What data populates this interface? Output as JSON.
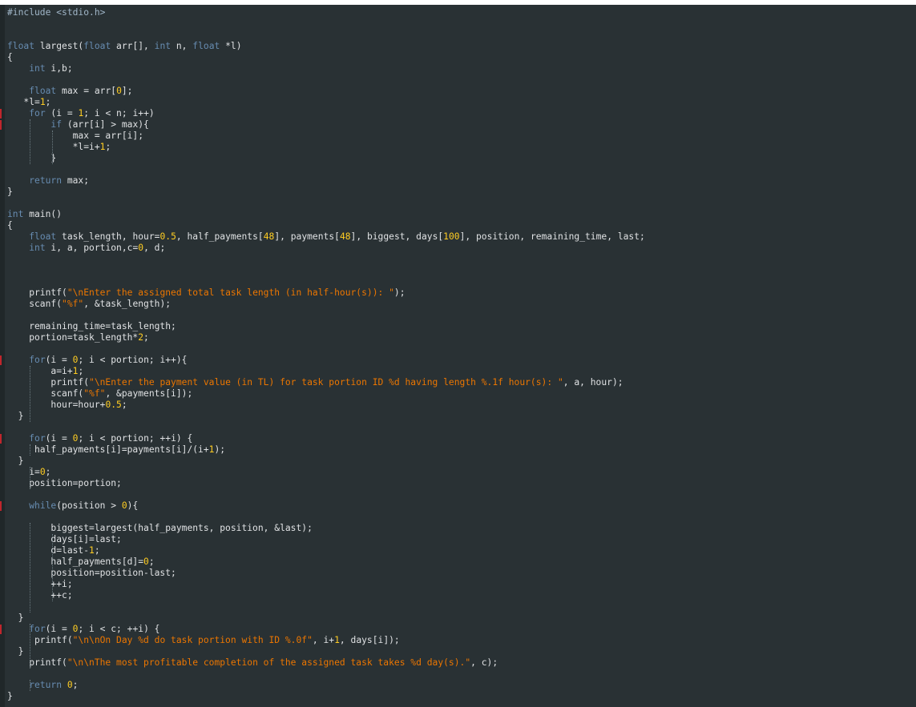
{
  "editor": {
    "language": "c",
    "theme_colors": {
      "background": "#293134",
      "keyword": "#678cb1",
      "string": "#ec7600",
      "number": "#ffcd22",
      "preprocessor": "#a1b7c9",
      "identifier": "#e0e2e4",
      "marker": "#c0262d"
    },
    "lines": [
      {
        "tokens": [
          {
            "t": "#include <stdio.h>",
            "c": "pp"
          }
        ]
      },
      {
        "tokens": []
      },
      {
        "tokens": []
      },
      {
        "tokens": [
          {
            "t": "float",
            "c": "kw"
          },
          {
            "t": " largest(",
            "c": "id"
          },
          {
            "t": "float",
            "c": "kw"
          },
          {
            "t": " arr[], ",
            "c": "id"
          },
          {
            "t": "int",
            "c": "kw"
          },
          {
            "t": " n, ",
            "c": "id"
          },
          {
            "t": "float",
            "c": "kw"
          },
          {
            "t": " *l)",
            "c": "id"
          }
        ]
      },
      {
        "tokens": [
          {
            "t": "{",
            "c": "id"
          }
        ]
      },
      {
        "tokens": [
          {
            "t": "    ",
            "c": "id"
          },
          {
            "t": "int",
            "c": "kw"
          },
          {
            "t": " i,b;",
            "c": "id"
          }
        ]
      },
      {
        "tokens": []
      },
      {
        "tokens": [
          {
            "t": "    ",
            "c": "id"
          },
          {
            "t": "float",
            "c": "kw"
          },
          {
            "t": " max = arr[",
            "c": "id"
          },
          {
            "t": "0",
            "c": "num"
          },
          {
            "t": "];",
            "c": "id"
          }
        ]
      },
      {
        "tokens": [
          {
            "t": "   *l=",
            "c": "id"
          },
          {
            "t": "1",
            "c": "num"
          },
          {
            "t": ";",
            "c": "id"
          }
        ]
      },
      {
        "marker": true,
        "tokens": [
          {
            "t": "    ",
            "c": "id"
          },
          {
            "t": "for",
            "c": "kw"
          },
          {
            "t": " (i = ",
            "c": "id"
          },
          {
            "t": "1",
            "c": "num"
          },
          {
            "t": "; i < n; i++)",
            "c": "id"
          }
        ]
      },
      {
        "marker": true,
        "tokens": [
          {
            "t": "        ",
            "c": "id"
          },
          {
            "t": "if",
            "c": "kw"
          },
          {
            "t": " (arr[i] > max){",
            "c": "id"
          }
        ]
      },
      {
        "tokens": [
          {
            "t": "            max = arr[i];",
            "c": "id"
          }
        ]
      },
      {
        "tokens": [
          {
            "t": "            *l=i+",
            "c": "id"
          },
          {
            "t": "1",
            "c": "num"
          },
          {
            "t": ";",
            "c": "id"
          }
        ]
      },
      {
        "tokens": [
          {
            "t": "        }",
            "c": "id"
          }
        ]
      },
      {
        "tokens": []
      },
      {
        "tokens": [
          {
            "t": "    ",
            "c": "id"
          },
          {
            "t": "return",
            "c": "kw"
          },
          {
            "t": " max;",
            "c": "id"
          }
        ]
      },
      {
        "tokens": [
          {
            "t": "}",
            "c": "id"
          }
        ]
      },
      {
        "tokens": []
      },
      {
        "tokens": [
          {
            "t": "int",
            "c": "kw"
          },
          {
            "t": " main()",
            "c": "id"
          }
        ]
      },
      {
        "tokens": [
          {
            "t": "{",
            "c": "id"
          }
        ]
      },
      {
        "tokens": [
          {
            "t": "    ",
            "c": "id"
          },
          {
            "t": "float",
            "c": "kw"
          },
          {
            "t": " task_length, hour=",
            "c": "id"
          },
          {
            "t": "0.5",
            "c": "num"
          },
          {
            "t": ", half_payments[",
            "c": "id"
          },
          {
            "t": "48",
            "c": "num"
          },
          {
            "t": "], payments[",
            "c": "id"
          },
          {
            "t": "48",
            "c": "num"
          },
          {
            "t": "], biggest, days[",
            "c": "id"
          },
          {
            "t": "100",
            "c": "num"
          },
          {
            "t": "], position, remaining_time, last;",
            "c": "id"
          }
        ]
      },
      {
        "tokens": [
          {
            "t": "    ",
            "c": "id"
          },
          {
            "t": "int",
            "c": "kw"
          },
          {
            "t": " i, a, portion,c=",
            "c": "id"
          },
          {
            "t": "0",
            "c": "num"
          },
          {
            "t": ", d;",
            "c": "id"
          }
        ]
      },
      {
        "tokens": []
      },
      {
        "tokens": []
      },
      {
        "tokens": []
      },
      {
        "tokens": [
          {
            "t": "    printf(",
            "c": "id"
          },
          {
            "t": "\"\\nEnter the assigned total task length (in half-hour(s)): \"",
            "c": "str"
          },
          {
            "t": ");",
            "c": "id"
          }
        ]
      },
      {
        "tokens": [
          {
            "t": "    scanf(",
            "c": "id"
          },
          {
            "t": "\"%f\"",
            "c": "str"
          },
          {
            "t": ", &task_length);",
            "c": "id"
          }
        ]
      },
      {
        "tokens": []
      },
      {
        "tokens": [
          {
            "t": "    remaining_time=task_length;",
            "c": "id"
          }
        ]
      },
      {
        "tokens": [
          {
            "t": "    portion=task_length*",
            "c": "id"
          },
          {
            "t": "2",
            "c": "num"
          },
          {
            "t": ";",
            "c": "id"
          }
        ]
      },
      {
        "tokens": []
      },
      {
        "marker": true,
        "tokens": [
          {
            "t": "    ",
            "c": "id"
          },
          {
            "t": "for",
            "c": "kw"
          },
          {
            "t": "(i = ",
            "c": "id"
          },
          {
            "t": "0",
            "c": "num"
          },
          {
            "t": "; i < portion; i++){",
            "c": "id"
          }
        ]
      },
      {
        "tokens": [
          {
            "t": "        a=i+",
            "c": "id"
          },
          {
            "t": "1",
            "c": "num"
          },
          {
            "t": ";",
            "c": "id"
          }
        ]
      },
      {
        "tokens": [
          {
            "t": "        printf(",
            "c": "id"
          },
          {
            "t": "\"\\nEnter the payment value (in TL) for task portion ID %d having length %.1f hour(s): \"",
            "c": "str"
          },
          {
            "t": ", a, hour);",
            "c": "id"
          }
        ]
      },
      {
        "tokens": [
          {
            "t": "        scanf(",
            "c": "id"
          },
          {
            "t": "\"%f\"",
            "c": "str"
          },
          {
            "t": ", &payments[i]);",
            "c": "id"
          }
        ]
      },
      {
        "tokens": [
          {
            "t": "        hour=hour+",
            "c": "id"
          },
          {
            "t": "0.5",
            "c": "num"
          },
          {
            "t": ";",
            "c": "id"
          }
        ]
      },
      {
        "tokens": [
          {
            "t": "  }",
            "c": "id"
          }
        ]
      },
      {
        "tokens": []
      },
      {
        "marker": true,
        "tokens": [
          {
            "t": "    ",
            "c": "id"
          },
          {
            "t": "for",
            "c": "kw"
          },
          {
            "t": "(i = ",
            "c": "id"
          },
          {
            "t": "0",
            "c": "num"
          },
          {
            "t": "; i < portion; ++i) {",
            "c": "id"
          }
        ]
      },
      {
        "tokens": [
          {
            "t": "     half_payments[i]=payments[i]/(i+",
            "c": "id"
          },
          {
            "t": "1",
            "c": "num"
          },
          {
            "t": ");",
            "c": "id"
          }
        ]
      },
      {
        "tokens": [
          {
            "t": "  }",
            "c": "id"
          }
        ]
      },
      {
        "tokens": [
          {
            "t": "    i=",
            "c": "id"
          },
          {
            "t": "0",
            "c": "num"
          },
          {
            "t": ";",
            "c": "id"
          }
        ]
      },
      {
        "tokens": [
          {
            "t": "    position=portion;",
            "c": "id"
          }
        ]
      },
      {
        "tokens": []
      },
      {
        "marker": true,
        "tokens": [
          {
            "t": "    ",
            "c": "id"
          },
          {
            "t": "while",
            "c": "kw"
          },
          {
            "t": "(position > ",
            "c": "id"
          },
          {
            "t": "0",
            "c": "num"
          },
          {
            "t": "){",
            "c": "id"
          }
        ]
      },
      {
        "tokens": []
      },
      {
        "tokens": [
          {
            "t": "        biggest=largest(half_payments, position, &last);",
            "c": "id"
          }
        ]
      },
      {
        "tokens": [
          {
            "t": "        days[i]=last;",
            "c": "id"
          }
        ]
      },
      {
        "tokens": [
          {
            "t": "        d=last-",
            "c": "id"
          },
          {
            "t": "1",
            "c": "num"
          },
          {
            "t": ";",
            "c": "id"
          }
        ]
      },
      {
        "tokens": [
          {
            "t": "        half_payments[d]=",
            "c": "id"
          },
          {
            "t": "0",
            "c": "num"
          },
          {
            "t": ";",
            "c": "id"
          }
        ]
      },
      {
        "tokens": [
          {
            "t": "        position=position-last;",
            "c": "id"
          }
        ]
      },
      {
        "tokens": [
          {
            "t": "        ++i;",
            "c": "id"
          }
        ]
      },
      {
        "tokens": [
          {
            "t": "        ++c;",
            "c": "id"
          }
        ]
      },
      {
        "tokens": []
      },
      {
        "tokens": [
          {
            "t": "  }",
            "c": "id"
          }
        ]
      },
      {
        "marker": true,
        "tokens": [
          {
            "t": "    ",
            "c": "id"
          },
          {
            "t": "for",
            "c": "kw"
          },
          {
            "t": "(i = ",
            "c": "id"
          },
          {
            "t": "0",
            "c": "num"
          },
          {
            "t": "; i < c; ++i) {",
            "c": "id"
          }
        ]
      },
      {
        "tokens": [
          {
            "t": "     printf(",
            "c": "id"
          },
          {
            "t": "\"\\n\\nOn Day %d do task portion with ID %.0f\"",
            "c": "str"
          },
          {
            "t": ", i+",
            "c": "id"
          },
          {
            "t": "1",
            "c": "num"
          },
          {
            "t": ", days[i]);",
            "c": "id"
          }
        ]
      },
      {
        "tokens": [
          {
            "t": "  }",
            "c": "id"
          }
        ]
      },
      {
        "tokens": [
          {
            "t": "    printf(",
            "c": "id"
          },
          {
            "t": "\"\\n\\nThe most profitable completion of the assigned task takes %d day(s).\"",
            "c": "str"
          },
          {
            "t": ", c);",
            "c": "id"
          }
        ]
      },
      {
        "tokens": []
      },
      {
        "tokens": [
          {
            "t": "    ",
            "c": "id"
          },
          {
            "t": "return",
            "c": "kw"
          },
          {
            "t": " ",
            "c": "id"
          },
          {
            "t": "0",
            "c": "num"
          },
          {
            "t": ";",
            "c": "id"
          }
        ]
      },
      {
        "tokens": [
          {
            "t": "}",
            "c": "id"
          }
        ]
      }
    ]
  }
}
